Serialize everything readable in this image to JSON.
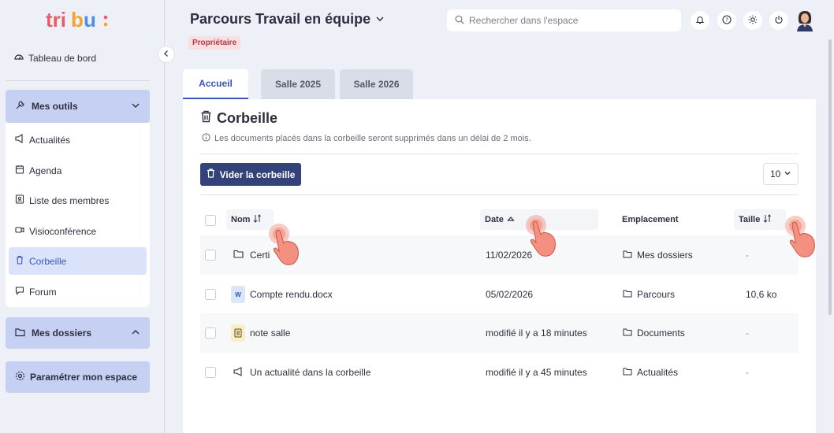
{
  "colors": {
    "accent": "#3a57b8",
    "primary_button": "#34427a",
    "badge_bg": "#f8dfe0",
    "badge_text": "#b33b45",
    "sidebar_header": "#c5d0f3"
  },
  "sidebar": {
    "logo_text": "tribu:",
    "dashboard_label": "Tableau de bord",
    "tools_header": "Mes outils",
    "tools": [
      {
        "label": "Actualités",
        "icon": "megaphone-icon"
      },
      {
        "label": "Agenda",
        "icon": "calendar-icon"
      },
      {
        "label": "Liste des membres",
        "icon": "members-icon"
      },
      {
        "label": "Visioconférence",
        "icon": "video-icon"
      },
      {
        "label": "Corbeille",
        "icon": "trash-icon",
        "active": true
      },
      {
        "label": "Forum",
        "icon": "chat-icon"
      }
    ],
    "folders_header": "Mes dossiers",
    "settings_label": "Paramétrer mon espace"
  },
  "header": {
    "title": "Parcours Travail en équipe",
    "badge": "Propriétaire",
    "search_placeholder": "Rechercher dans l'espace"
  },
  "tabs": [
    {
      "label": "Accueil",
      "active": true
    },
    {
      "label": "Salle 2025",
      "active": false
    },
    {
      "label": "Salle 2026",
      "active": false
    }
  ],
  "main": {
    "title": "Corbeille",
    "info": "Les documents placés dans la corbeille seront supprimés dans un délai de 2 mois.",
    "empty_button": "Vider la corbeille",
    "per_page": "10",
    "columns": {
      "name": "Nom",
      "date": "Date",
      "location": "Emplacement",
      "size": "Taille"
    },
    "rows": [
      {
        "name": "Certi",
        "type": "folder",
        "date": "11/02/2026",
        "location": "Mes dossiers",
        "size": "-"
      },
      {
        "name": "Compte rendu.docx",
        "type": "word",
        "date": "05/02/2026",
        "location": "Parcours",
        "size": "10,6 ko"
      },
      {
        "name": "note salle",
        "type": "note",
        "date": "modifié il y a 18 minutes",
        "location": "Documents",
        "size": "-"
      },
      {
        "name": "Un actualité dans la corbeille",
        "type": "news",
        "date": "modifié il y a 45 minutes",
        "location": "Actualités",
        "size": "-"
      }
    ]
  }
}
